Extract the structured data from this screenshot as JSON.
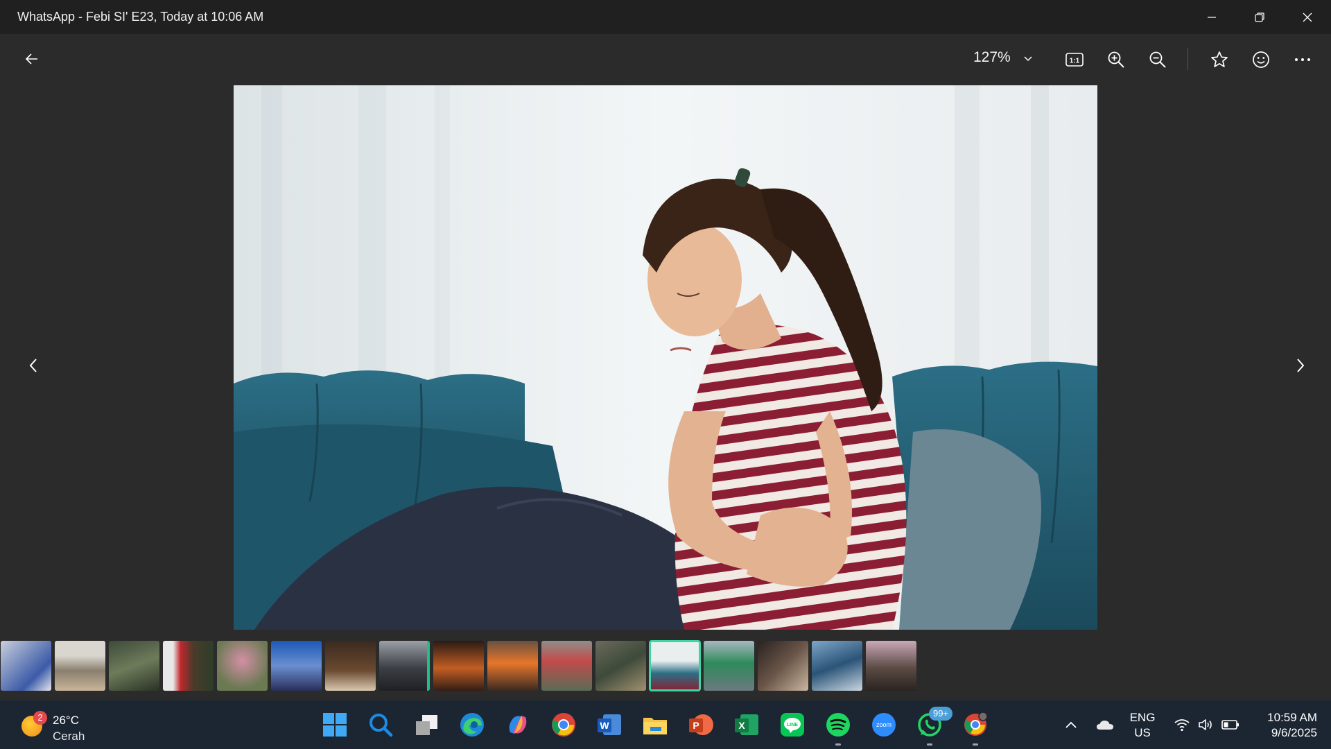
{
  "window": {
    "title": "WhatsApp - Febi SI' E23, Today at 10:06 AM",
    "controls": [
      "minimize-icon",
      "restore-icon",
      "close-icon"
    ]
  },
  "toolbar": {
    "zoom_level": "127%",
    "actual_size_label": "1:1",
    "icons": [
      "back-arrow-icon",
      "chevron-down-icon",
      "actual-size-icon",
      "zoom-in-icon",
      "zoom-out-icon",
      "star-icon",
      "smiley-icon",
      "more-icon"
    ]
  },
  "viewer": {
    "photo_subject": "woman in striped shirt holding stomach on teal sofa",
    "nav": [
      "chevron-left-icon",
      "chevron-right-icon"
    ]
  },
  "filmstrip": {
    "count": 17,
    "active_index": 12
  },
  "taskbar": {
    "weather": {
      "badge": "2",
      "temperature": "26°C",
      "condition": "Cerah"
    },
    "apps": [
      "Start",
      "Search",
      "Task View",
      "Edge",
      "Copilot",
      "Chrome",
      "Word",
      "File Explorer",
      "PowerPoint",
      "Excel",
      "LINE",
      "Spotify",
      "Zoom",
      "WhatsApp",
      "Chrome profile"
    ],
    "zoom_label": "zoom",
    "whatsapp_badge": "99+",
    "language": {
      "line1": "ENG",
      "line2": "US"
    },
    "clock": {
      "time": "10:59 AM",
      "date": "9/6/2025"
    }
  },
  "colors": {
    "titlebar": "#202020",
    "background": "#2b2b2b",
    "taskbar": "#1c2633",
    "accent": "#3dd6a3"
  }
}
